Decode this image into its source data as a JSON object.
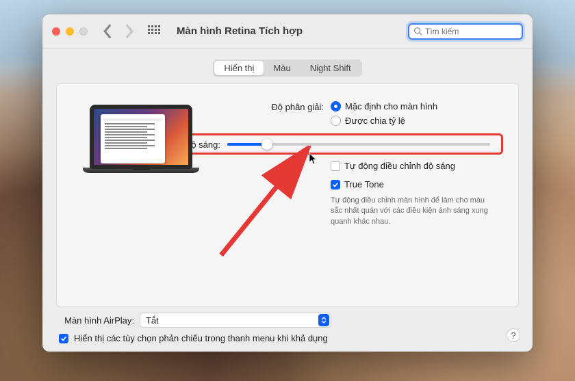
{
  "window": {
    "title": "Màn hình Retina Tích hợp",
    "search_placeholder": "Tìm kiếm"
  },
  "tabs": {
    "display": "Hiển thị",
    "color": "Màu",
    "night_shift": "Night Shift",
    "active": "display"
  },
  "resolution": {
    "label": "Độ phân giải:",
    "option_default": "Mặc định cho màn hình",
    "option_scaled": "Được chia tỷ lệ",
    "selected": "default"
  },
  "brightness": {
    "label": "Độ sáng:",
    "value_percent": 15,
    "auto_label": "Tự động điều chỉnh độ sáng",
    "auto_checked": false
  },
  "truetone": {
    "label": "True Tone",
    "checked": true,
    "description": "Tự động điều chỉnh màn hình để làm cho màu sắc nhất quán với các điều kiện ánh sáng xung quanh khác nhau."
  },
  "airplay": {
    "label": "Màn hình AirPlay:",
    "value": "Tắt"
  },
  "mirror": {
    "label": "Hiển thị các tùy chọn phản chiếu trong thanh menu khi khả dụng",
    "checked": true
  },
  "help": "?"
}
